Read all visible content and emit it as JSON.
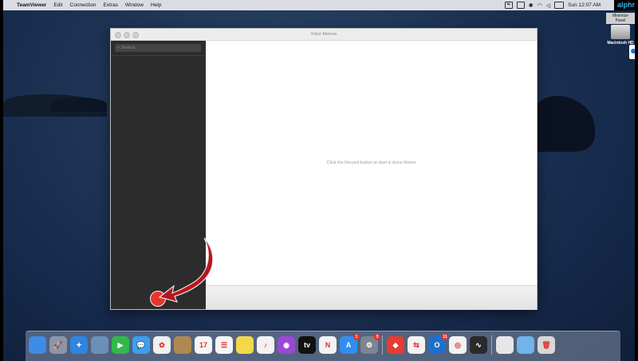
{
  "menubar": {
    "apple": "",
    "items": [
      "TeamViewer",
      "Edit",
      "Connection",
      "Extras",
      "Window",
      "Help"
    ],
    "clock": "Sun 12:07 AM"
  },
  "watermark": {
    "prefix": "alphr",
    "suffix": ""
  },
  "desktop": {
    "drive_label": "Macintosh HD",
    "drive_title": "Minimize Panel"
  },
  "window": {
    "title": "Voice Memos",
    "search_placeholder": "Search",
    "empty_message": "Click the Record button to start a Voice Memo"
  },
  "dock": {
    "apps": [
      {
        "name": "finder-icon",
        "color": "#3d8ce8",
        "glyph": ""
      },
      {
        "name": "launchpad-icon",
        "color": "#8c96a8",
        "glyph": "🚀"
      },
      {
        "name": "safari-icon",
        "color": "#2d85e0",
        "glyph": "✦"
      },
      {
        "name": "preview-icon",
        "color": "#6c8fb8",
        "glyph": ""
      },
      {
        "name": "facetime-icon",
        "color": "#33b84a",
        "glyph": "▶"
      },
      {
        "name": "messages-icon",
        "color": "#3aa0f0",
        "glyph": "💬"
      },
      {
        "name": "photos-icon",
        "color": "#f0f0f0",
        "glyph": "✿"
      },
      {
        "name": "contacts-icon",
        "color": "#b08852",
        "glyph": ""
      },
      {
        "name": "calendar-icon",
        "color": "#f5f5f5",
        "glyph": "17"
      },
      {
        "name": "reminders-icon",
        "color": "#f5f5f5",
        "glyph": "☰"
      },
      {
        "name": "notes-icon",
        "color": "#f4d84a",
        "glyph": ""
      },
      {
        "name": "music-icon",
        "color": "#f2f2f2",
        "glyph": "♪"
      },
      {
        "name": "podcasts-icon",
        "color": "#9b47d6",
        "glyph": "◉"
      },
      {
        "name": "apple-tv-icon",
        "color": "#111111",
        "glyph": "tv"
      },
      {
        "name": "news-icon",
        "color": "#f2f2f2",
        "glyph": "N"
      },
      {
        "name": "app-store-icon",
        "color": "#2f8ff0",
        "glyph": "A",
        "badge": "1"
      },
      {
        "name": "system-preferences-icon",
        "color": "#7d8590",
        "glyph": "⚙",
        "badge": "3"
      }
    ],
    "apps2": [
      {
        "name": "anydesk-icon",
        "color": "#e63b33",
        "glyph": "◆"
      },
      {
        "name": "teamviewer-icon",
        "color": "#f2f2f2",
        "glyph": "⇆"
      },
      {
        "name": "outlook-icon",
        "color": "#1e6fcc",
        "glyph": "O",
        "badge": "11"
      },
      {
        "name": "chrome-icon",
        "color": "#f2f2f2",
        "glyph": "◎"
      },
      {
        "name": "voice-memos-icon",
        "color": "#2a2a2a",
        "glyph": "∿"
      }
    ],
    "apps3": [
      {
        "name": "document-icon",
        "color": "#e6e6e6",
        "glyph": ""
      },
      {
        "name": "folder-icon",
        "color": "#6fb4ea",
        "glyph": ""
      },
      {
        "name": "trash-icon",
        "color": "#d8d8d8",
        "glyph": "🗑"
      }
    ]
  }
}
